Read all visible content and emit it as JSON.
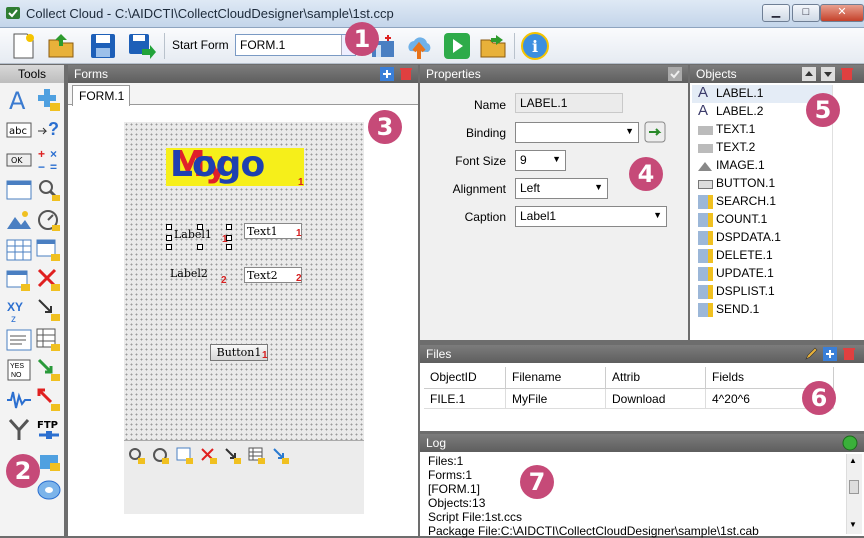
{
  "window": {
    "title": "Collect Cloud - C:\\AIDCTI\\CollectCloudDesigner\\sample\\1st.ccp"
  },
  "toolbar": {
    "start_form_label": "Start Form",
    "start_form_value": "FORM.1"
  },
  "panels": {
    "tools_title": "Tools",
    "forms_title": "Forms",
    "properties_title": "Properties",
    "objects_title": "Objects",
    "files_title": "Files",
    "log_title": "Log"
  },
  "forms": {
    "tab": "FORM.1",
    "logo_text": "MyLogo",
    "label1": "Label1",
    "label2": "Label2",
    "text1": "Text1",
    "text2": "Text2",
    "button1": "Button1",
    "marks": {
      "logo": "1",
      "label1": "1",
      "text1": "1",
      "label2": "2",
      "text2": "2",
      "button1": "1"
    }
  },
  "properties": {
    "name_label": "Name",
    "name_value": "LABEL.1",
    "binding_label": "Binding",
    "binding_value": "",
    "fontsize_label": "Font Size",
    "fontsize_value": "9",
    "alignment_label": "Alignment",
    "alignment_value": "Left",
    "caption_label": "Caption",
    "caption_value": "Label1"
  },
  "objects": [
    "LABEL.1",
    "LABEL.2",
    "TEXT.1",
    "TEXT.2",
    "IMAGE.1",
    "BUTTON.1",
    "SEARCH.1",
    "COUNT.1",
    "DSPDATA.1",
    "DELETE.1",
    "UPDATE.1",
    "DSPLIST.1",
    "SEND.1"
  ],
  "files": {
    "headers": [
      "ObjectID",
      "Filename",
      "Attrib",
      "Fields"
    ],
    "rows": [
      [
        "FILE.1",
        "MyFile",
        "Download",
        "4^20^6"
      ]
    ]
  },
  "log": {
    "lines": [
      "Files:1",
      "Forms:1",
      "[FORM.1]",
      "Objects:13",
      "Script File:1st.ccs",
      "Package File:C:\\AIDCTI\\CollectCloudDesigner\\sample\\1st.cab"
    ]
  },
  "callouts": [
    "1",
    "2",
    "3",
    "4",
    "5",
    "6",
    "7"
  ],
  "colors": {
    "callout": "#c64a78",
    "panel_header": "#6a6a6a",
    "logo_bg": "#f6ef1a",
    "logo_red": "#e0202a",
    "logo_blue": "#1e40b0"
  }
}
